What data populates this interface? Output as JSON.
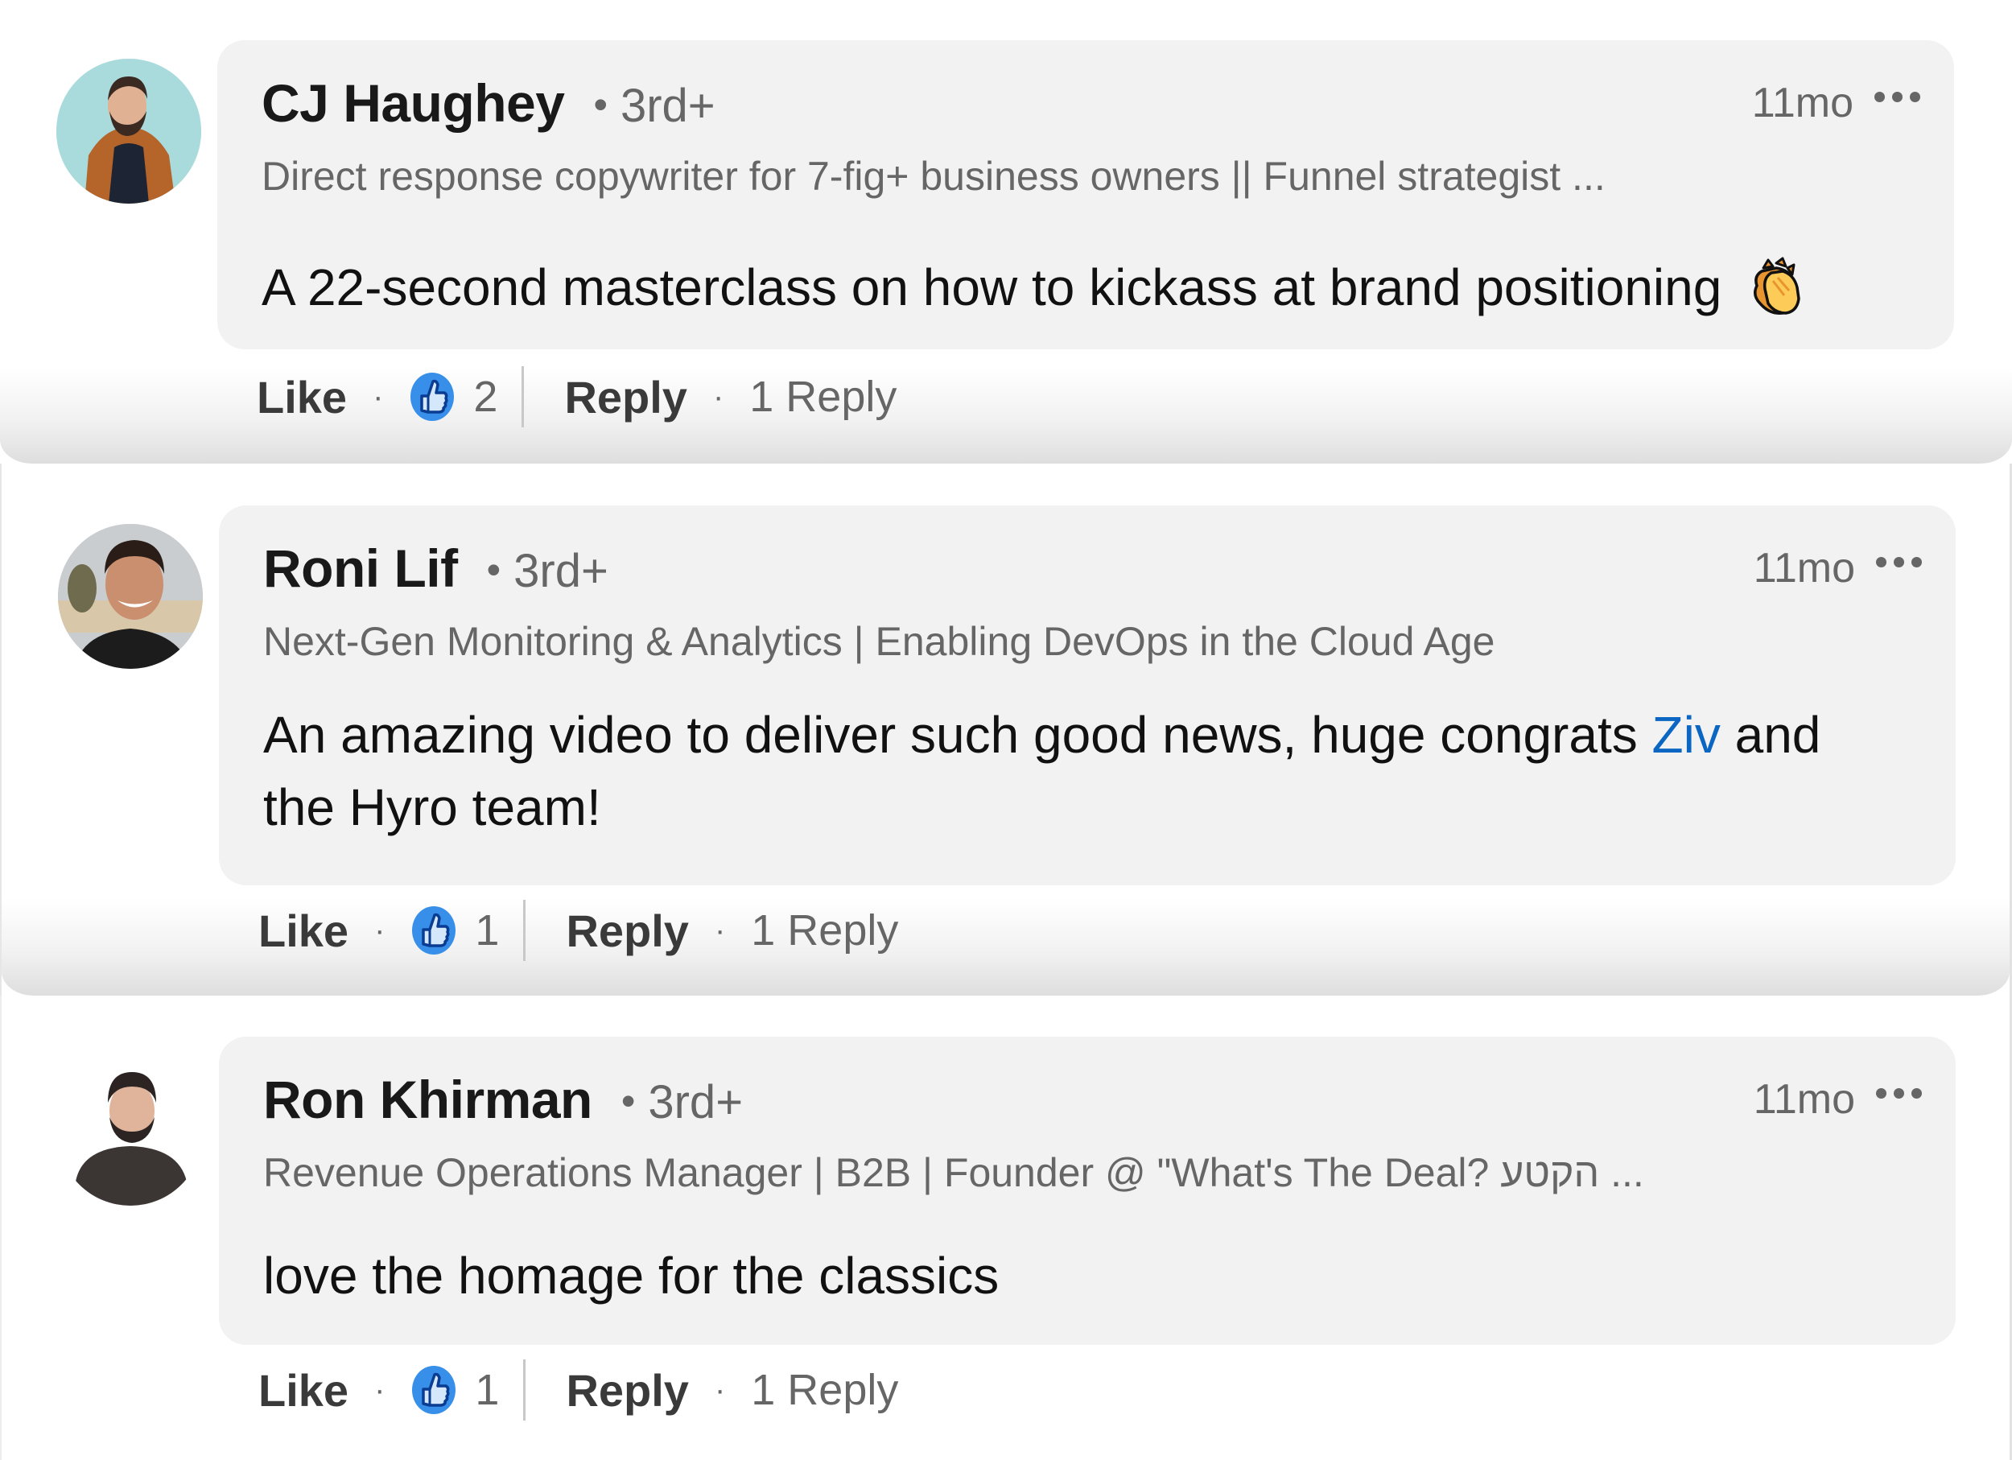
{
  "comments": [
    {
      "author": "CJ Haughey",
      "degree": "3rd+",
      "headline": "Direct response copywriter for 7-fig+ business owners || Funnel strategist ...",
      "time": "11mo",
      "body_before": "A 22-second masterclass on how to kickass at brand positioning",
      "mention": "",
      "body_after": "",
      "emoji": "clapping-hands",
      "like_label": "Like",
      "reaction_count": "2",
      "reply_label": "Reply",
      "replies_label": "1 Reply",
      "avatar_bg": "#a9dadc"
    },
    {
      "author": "Roni Lif",
      "degree": "3rd+",
      "headline": "Next-Gen Monitoring & Analytics | Enabling DevOps in the Cloud Age",
      "time": "11mo",
      "body_before": "An amazing video to deliver such good news, huge congrats ",
      "mention": "Ziv",
      "body_after": " and the Hyro team!",
      "emoji": "",
      "like_label": "Like",
      "reaction_count": "1",
      "reply_label": "Reply",
      "replies_label": "1 Reply",
      "avatar_bg": "#b9c3c9"
    },
    {
      "author": "Ron Khirman",
      "degree": "3rd+",
      "headline": "Revenue Operations Manager | B2B | Founder @ \"What's The Deal? הקטע ...",
      "time": "11mo",
      "body_before": "love the homage for the classics",
      "mention": "",
      "body_after": "",
      "emoji": "",
      "like_label": "Like",
      "reaction_count": "1",
      "reply_label": "Reply",
      "replies_label": "1 Reply",
      "avatar_bg": "#ffffff"
    }
  ],
  "icons": {
    "reaction": "like-thumbs-up-icon",
    "more": "more-options-icon"
  },
  "colors": {
    "card_bg": "#f2f2f2",
    "mention": "#0a66c2",
    "reaction_blue": "#378fe9",
    "secondary_text": "#666666"
  }
}
